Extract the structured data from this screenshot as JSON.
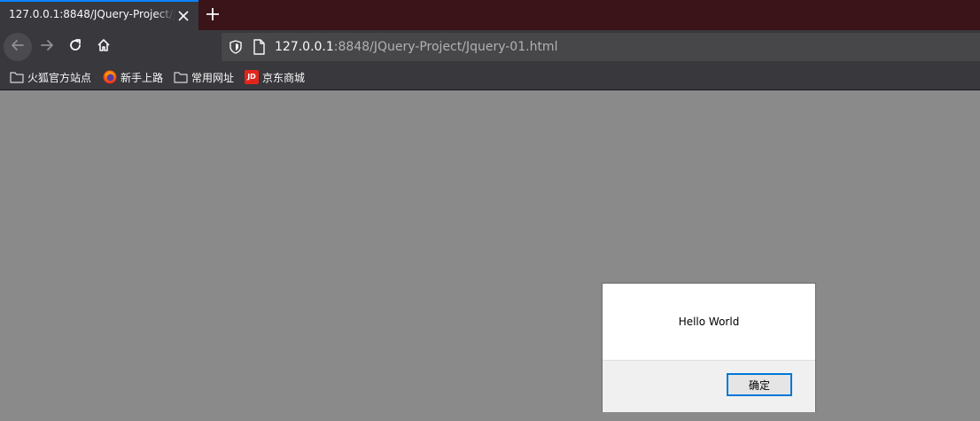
{
  "tab": {
    "title": "127.0.0.1:8848/JQuery-Project/Jquery-01.html",
    "close_icon": "close-icon",
    "new_tab_icon": "plus-icon"
  },
  "nav": {
    "back_icon": "arrow-left-icon",
    "forward_icon": "arrow-right-icon",
    "reload_icon": "reload-icon",
    "home_icon": "home-icon"
  },
  "url": {
    "host": "127.0.0.1",
    "rest": ":8848/JQuery-Project/Jquery-01.html",
    "shield_icon": "shield-icon",
    "page_icon": "page-icon"
  },
  "bookmarks": [
    {
      "label": "火狐官方站点",
      "icon": "folder-icon"
    },
    {
      "label": "新手上路",
      "icon": "firefox-icon"
    },
    {
      "label": "常用网址",
      "icon": "folder-icon"
    },
    {
      "label": "京东商城",
      "icon": "jd-logo-icon",
      "logo_text": "JD"
    }
  ],
  "dialog": {
    "message": "Hello World",
    "ok_label": "确定"
  },
  "colors": {
    "tab_accent": "#0a84ff",
    "toolbar": "#38383d",
    "page_overlay": "#8a8a8a",
    "dialog_button_border": "#0078d7"
  }
}
